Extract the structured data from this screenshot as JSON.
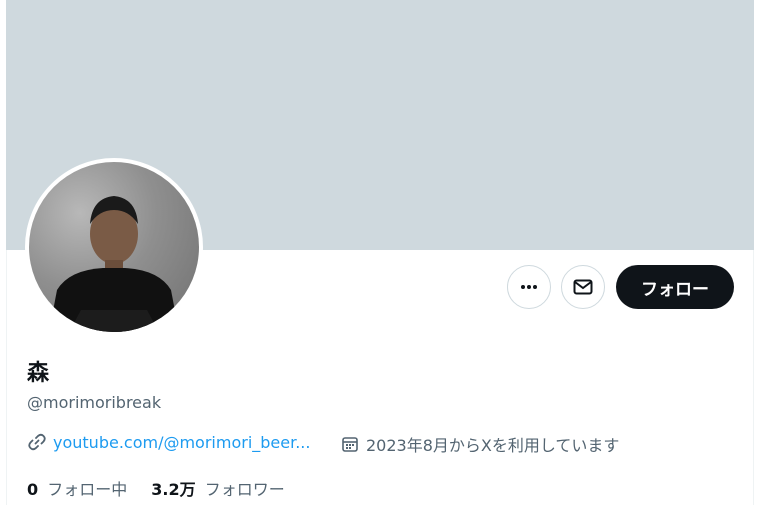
{
  "profile": {
    "name": "森",
    "handle": "@morimoribreak",
    "link_text": "youtube.com/@morimori_beer...",
    "joined_text": "2023年8月からXを利用しています",
    "following_count": "0",
    "following_label": "フォロー中",
    "followers_count": "3.2万",
    "followers_label": "フォロワー"
  },
  "actions": {
    "follow_label": "フォロー",
    "more_icon": "more-icon",
    "message_icon": "mail-icon"
  },
  "colors": {
    "banner": "#cfd9de",
    "link": "#1d9bf0",
    "follow_button": "#0f1419",
    "secondary_text": "#536471"
  }
}
